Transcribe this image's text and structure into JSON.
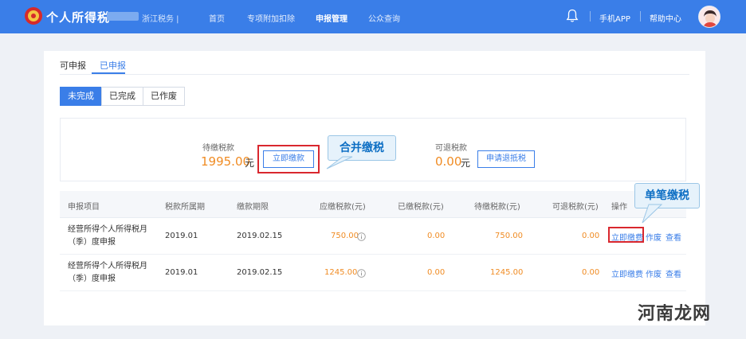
{
  "header": {
    "title": "个人所得税",
    "region": "浙江税务 |",
    "nav": [
      "首页",
      "专项附加扣除",
      "申报管理",
      "公众查询"
    ],
    "nav_active_index": 2,
    "mobile_app": "手机APP",
    "help": "帮助中心"
  },
  "tabs": {
    "items": [
      "可申报",
      "已申报"
    ],
    "active_index": 1
  },
  "segments": {
    "items": [
      "未完成",
      "已完成",
      "已作废"
    ],
    "active_index": 0
  },
  "summary": {
    "due_label": "待缴税款",
    "due_amount": "1995.00",
    "unit": "元",
    "pay_button": "立即缴款",
    "refund_label": "可退税款",
    "refund_amount": "0.00",
    "refund_button": "申请退抵税"
  },
  "callouts": {
    "merge": "合并缴税",
    "single": "单笔缴税"
  },
  "table": {
    "headers": [
      "申报项目",
      "税款所属期",
      "缴款期限",
      "应缴税款(元)",
      "已缴税款(元)",
      "待缴税款(元)",
      "可退税款(元)",
      "操作"
    ],
    "rows": [
      {
        "item": "经营所得个人所得税月（季）度申报",
        "period": "2019.01",
        "deadline": "2019.02.15",
        "payable": "750.00",
        "paid": "0.00",
        "pending": "750.00",
        "refundable": "0.00",
        "actions": [
          "立即缴费",
          "作废",
          "查看"
        ]
      },
      {
        "item": "经营所得个人所得税月（季）度申报",
        "period": "2019.01",
        "deadline": "2019.02.15",
        "payable": "1245.00",
        "paid": "0.00",
        "pending": "1245.00",
        "refundable": "0.00",
        "actions": [
          "立即缴费",
          "作废",
          "查看"
        ]
      }
    ]
  },
  "watermark": "河南龙网",
  "colors": {
    "primary": "#3a7ee8",
    "accent_orange": "#f08c24",
    "highlight_red": "#d9272e"
  }
}
